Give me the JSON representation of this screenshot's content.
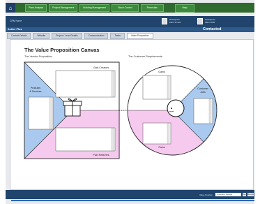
{
  "nav": {
    "buttons": [
      "Plant Analysis",
      "Project Management",
      "Building Management",
      "Stock Control",
      "Financials"
    ],
    "help": "Help"
  },
  "subbar": {
    "title": "CRM home",
    "app1": [
      "Workspace",
      "Main Screen"
    ],
    "app2": [
      "Workspace",
      "Main CRM"
    ]
  },
  "band": {
    "left": "Active Plus",
    "right": "Contacted"
  },
  "tabs": [
    {
      "label": "Contact Details",
      "active": false
    },
    {
      "label": "Website",
      "active": false
    },
    {
      "label": "Project / Lead Details",
      "active": false
    },
    {
      "label": "Communication",
      "active": false
    },
    {
      "label": "Tasks",
      "active": false
    },
    {
      "label": "Value Proposition",
      "active": true
    }
  ],
  "canvas": {
    "title": "The Value Proposition Canvas",
    "vendor_heading": "The Vendor Proposition",
    "customer_heading": "The Customer Requirements",
    "gain_creators": "Gain Creators",
    "products_services": [
      "Products",
      "& Services"
    ],
    "pain_relievers": "Pain Relievers",
    "gains": "Gains",
    "customer_jobs": [
      "Customer",
      "Jobs"
    ],
    "pains": "Pains"
  },
  "footer": {
    "label": "Value Position",
    "select": "Innovation Network",
    "go": "Go",
    "more": "Maximize"
  },
  "colors": {
    "blue_zone": "#a9c9ee",
    "pink_zone": "#f6c9ee",
    "nav_green": "#2f6b2f",
    "dark_blue": "#20446c"
  }
}
